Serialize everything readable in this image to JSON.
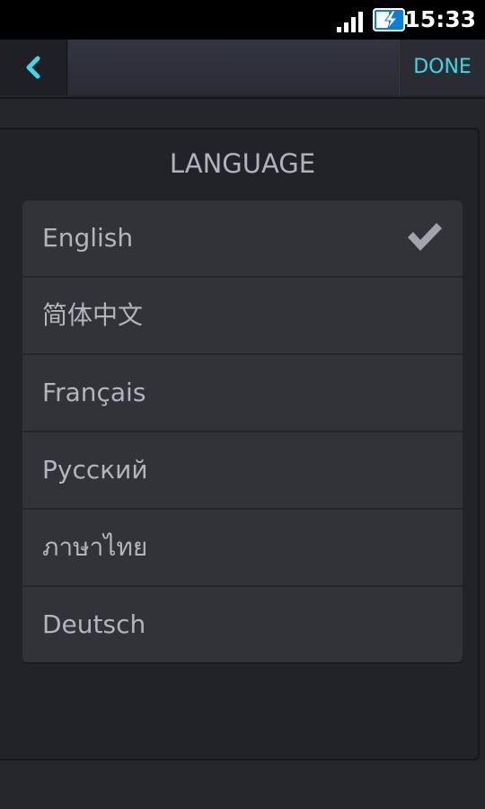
{
  "status_bar": {
    "time": "15:33",
    "signal_icon": "signal-bars-icon",
    "battery_icon": "battery-charging-icon"
  },
  "toolbar": {
    "back_icon": "chevron-left-icon",
    "done_label": "DONE"
  },
  "language_section": {
    "title": "LANGUAGE",
    "selected": "English",
    "items": [
      {
        "label": "English"
      },
      {
        "label": "简体中文"
      },
      {
        "label": "Français"
      },
      {
        "label": "Русский"
      },
      {
        "label": "ภาษาไทย"
      },
      {
        "label": "Deutsch"
      }
    ]
  },
  "colors": {
    "accent": "#3fd8e6",
    "background": "#25252c",
    "list_item": "#323239",
    "text": "#b4b4bc"
  }
}
